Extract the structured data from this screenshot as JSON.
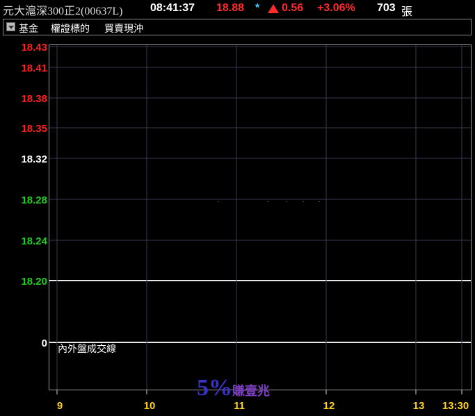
{
  "header": {
    "title": "元大滬深300正2(00637L)",
    "time": "08:41:37",
    "price": "18.88",
    "star": "*",
    "change": "0.56",
    "pct": "+3.06%",
    "volume": "703",
    "volume_unit": "張"
  },
  "toolbar": {
    "tab1": "基金",
    "tab2": "權證標的",
    "tab3": "買賣現沖"
  },
  "chart_data": {
    "type": "line",
    "y_ticks": [
      {
        "label": "18.43",
        "color": "#ff2020"
      },
      {
        "label": "18.41",
        "color": "#ff2020"
      },
      {
        "label": "18.38",
        "color": "#ff2020"
      },
      {
        "label": "18.35",
        "color": "#ff2020"
      },
      {
        "label": "18.32",
        "color": "#ffffff"
      },
      {
        "label": "18.28",
        "color": "#22cc22"
      },
      {
        "label": "18.24",
        "color": "#22cc22"
      },
      {
        "label": "18.20",
        "color": "#22cc22"
      },
      {
        "label": "0",
        "color": "#ffffff"
      }
    ],
    "x_ticks": [
      "9",
      "10",
      "11",
      "12",
      "13",
      "13:30"
    ],
    "sub_label": "內外盤成交線",
    "watermark_big": "5%",
    "watermark_small": "賺壹兆"
  }
}
